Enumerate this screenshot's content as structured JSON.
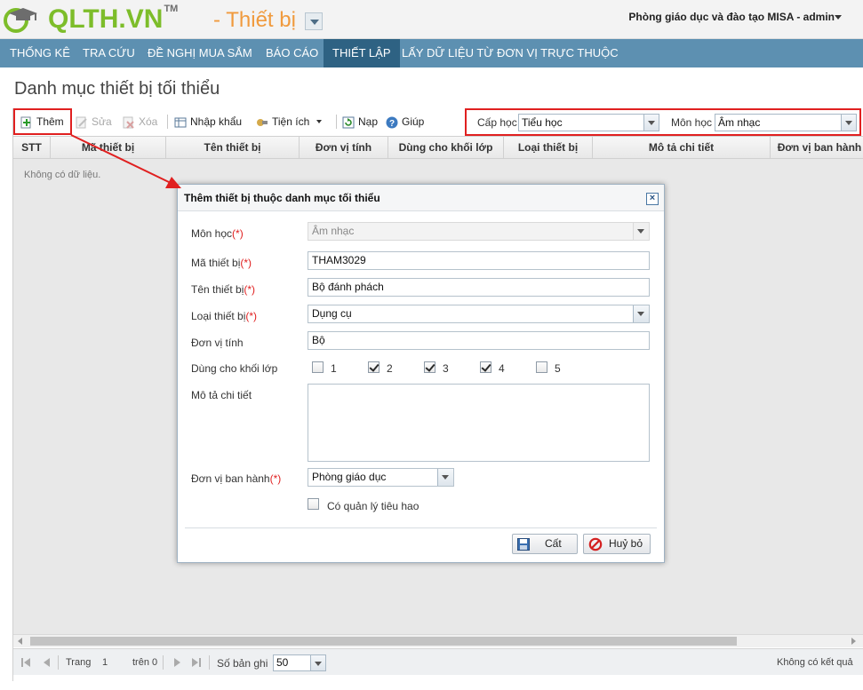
{
  "header": {
    "logo_text": "QLTH.VN",
    "logo_tm": "TM",
    "module_title": "- Thiết bị",
    "user_info": "Phòng giáo dục và đào tạo MISA - admin"
  },
  "nav": {
    "items": [
      {
        "label": "Thống kê"
      },
      {
        "label": "Tra cứu"
      },
      {
        "label": "Đề nghị mua sắm"
      },
      {
        "label": "Báo cáo"
      },
      {
        "label": "Thiết lập"
      },
      {
        "label": "Lấy dữ liệu từ đơn vị trực thuộc"
      }
    ],
    "active_index": 4
  },
  "page": {
    "title": "Danh mục thiết bị tối thiểu"
  },
  "toolbar": {
    "add": "Thêm",
    "edit": "Sửa",
    "delete": "Xóa",
    "import": "Nhập khẩu",
    "utilities": "Tiện ích",
    "reload": "Nạp",
    "help": "Giúp"
  },
  "filters": {
    "level_label": "Cấp học",
    "level_value": "Tiểu học",
    "subject_label": "Môn học",
    "subject_value": "Âm nhạc"
  },
  "grid": {
    "columns": [
      "STT",
      "Mã thiết bị",
      "Tên thiết bị",
      "Đơn vị tính",
      "Dùng cho khối lớp",
      "Loại thiết bị",
      "Mô tả chi tiết",
      "Đơn vị ban hành"
    ],
    "empty_text": "Không có dữ liệu."
  },
  "pager": {
    "page_label": "Trang",
    "page_value": "1",
    "of_label": "trên 0",
    "records_label": "Số bản ghi",
    "records_value": "50",
    "result_text": "Không có kết quả"
  },
  "dialog": {
    "title": "Thêm thiết bị thuộc danh mục tối thiểu",
    "required_mark": "(*)",
    "subject_label": "Môn học",
    "subject_value": "Âm nhạc",
    "code_label": "Mã thiết bị",
    "code_value": "THAM3029",
    "name_label": "Tên thiết bị",
    "name_value": "Bộ đánh phách",
    "type_label": "Loại thiết bị",
    "type_value": "Dụng cụ",
    "unit_label": "Đơn vị tính",
    "unit_value": "Bộ",
    "grades_label": "Dùng cho khối lớp",
    "grades": [
      {
        "label": "1",
        "checked": false
      },
      {
        "label": "2",
        "checked": true
      },
      {
        "label": "3",
        "checked": true
      },
      {
        "label": "4",
        "checked": true
      },
      {
        "label": "5",
        "checked": false
      }
    ],
    "desc_label": "Mô tả chi tiết",
    "desc_value": "",
    "issuer_label": "Đơn vị ban hành",
    "issuer_value": "Phòng giáo dục",
    "consumable_label": "Có quản lý tiêu hao",
    "consumable_checked": false,
    "save_label": "Cất",
    "cancel_label": "Huỷ bỏ"
  },
  "colors": {
    "brand_green": "#7dbd2a",
    "module_orange": "#f09a3d",
    "nav_bg": "#5d90b1",
    "nav_active": "#2e6283",
    "annotation_red": "#e02020"
  }
}
